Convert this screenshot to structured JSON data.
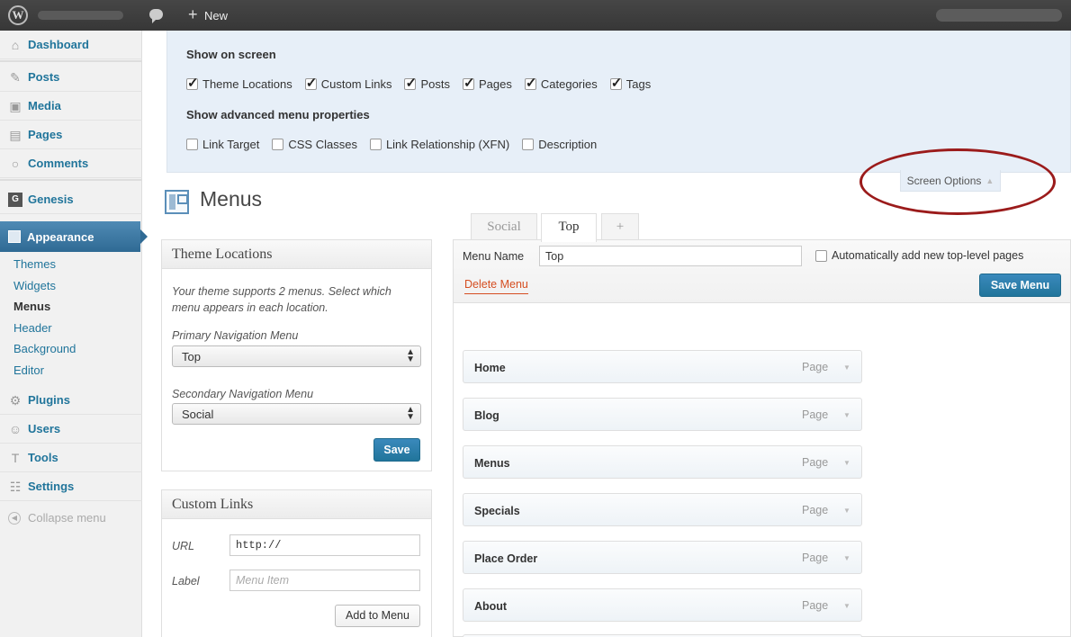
{
  "admin_bar": {
    "new_label": "New"
  },
  "sidebar": {
    "items": [
      {
        "label": "Dashboard",
        "icon": "home-icon"
      },
      {
        "label": "Posts",
        "icon": "pin-icon"
      },
      {
        "label": "Media",
        "icon": "media-icon"
      },
      {
        "label": "Pages",
        "icon": "pages-icon"
      },
      {
        "label": "Comments",
        "icon": "comment-icon"
      },
      {
        "label": "Genesis",
        "icon": "genesis-icon"
      },
      {
        "label": "Appearance",
        "icon": "appearance-icon"
      },
      {
        "label": "Plugins",
        "icon": "plugin-icon"
      },
      {
        "label": "Users",
        "icon": "users-icon"
      },
      {
        "label": "Tools",
        "icon": "tools-icon"
      },
      {
        "label": "Settings",
        "icon": "settings-icon"
      }
    ],
    "submenu": [
      "Themes",
      "Widgets",
      "Menus",
      "Header",
      "Background",
      "Editor"
    ],
    "collapse": "Collapse menu"
  },
  "screen_options": {
    "heading": "Show on screen",
    "boxes": [
      {
        "label": "Theme Locations",
        "checked": true
      },
      {
        "label": "Custom Links",
        "checked": true
      },
      {
        "label": "Posts",
        "checked": true
      },
      {
        "label": "Pages",
        "checked": true
      },
      {
        "label": "Categories",
        "checked": true
      },
      {
        "label": "Tags",
        "checked": true
      }
    ],
    "advanced_heading": "Show advanced menu properties",
    "advanced": [
      {
        "label": "Link Target",
        "checked": false
      },
      {
        "label": "CSS Classes",
        "checked": false
      },
      {
        "label": "Link Relationship (XFN)",
        "checked": false
      },
      {
        "label": "Description",
        "checked": false
      }
    ],
    "tab_label": "Screen Options"
  },
  "page": {
    "title": "Menus"
  },
  "theme_locations": {
    "title": "Theme Locations",
    "description": "Your theme supports 2 menus. Select which menu appears in each location.",
    "primary_label": "Primary Navigation Menu",
    "primary_value": "Top",
    "secondary_label": "Secondary Navigation Menu",
    "secondary_value": "Social",
    "save": "Save"
  },
  "custom_links": {
    "title": "Custom Links",
    "url_label": "URL",
    "url_value": "http://",
    "label_label": "Label",
    "label_placeholder": "Menu Item",
    "add": "Add to Menu"
  },
  "tabs": [
    "Social",
    "Top",
    "+"
  ],
  "editor": {
    "menu_name_label": "Menu Name",
    "menu_name_value": "Top",
    "auto_add": "Automatically add new top-level pages",
    "delete": "Delete Menu",
    "save": "Save Menu",
    "items": [
      {
        "title": "Home",
        "type": "Page"
      },
      {
        "title": "Blog",
        "type": "Page"
      },
      {
        "title": "Menus",
        "type": "Page"
      },
      {
        "title": "Specials",
        "type": "Page"
      },
      {
        "title": "Place Order",
        "type": "Page"
      },
      {
        "title": "About",
        "type": "Page"
      }
    ]
  }
}
